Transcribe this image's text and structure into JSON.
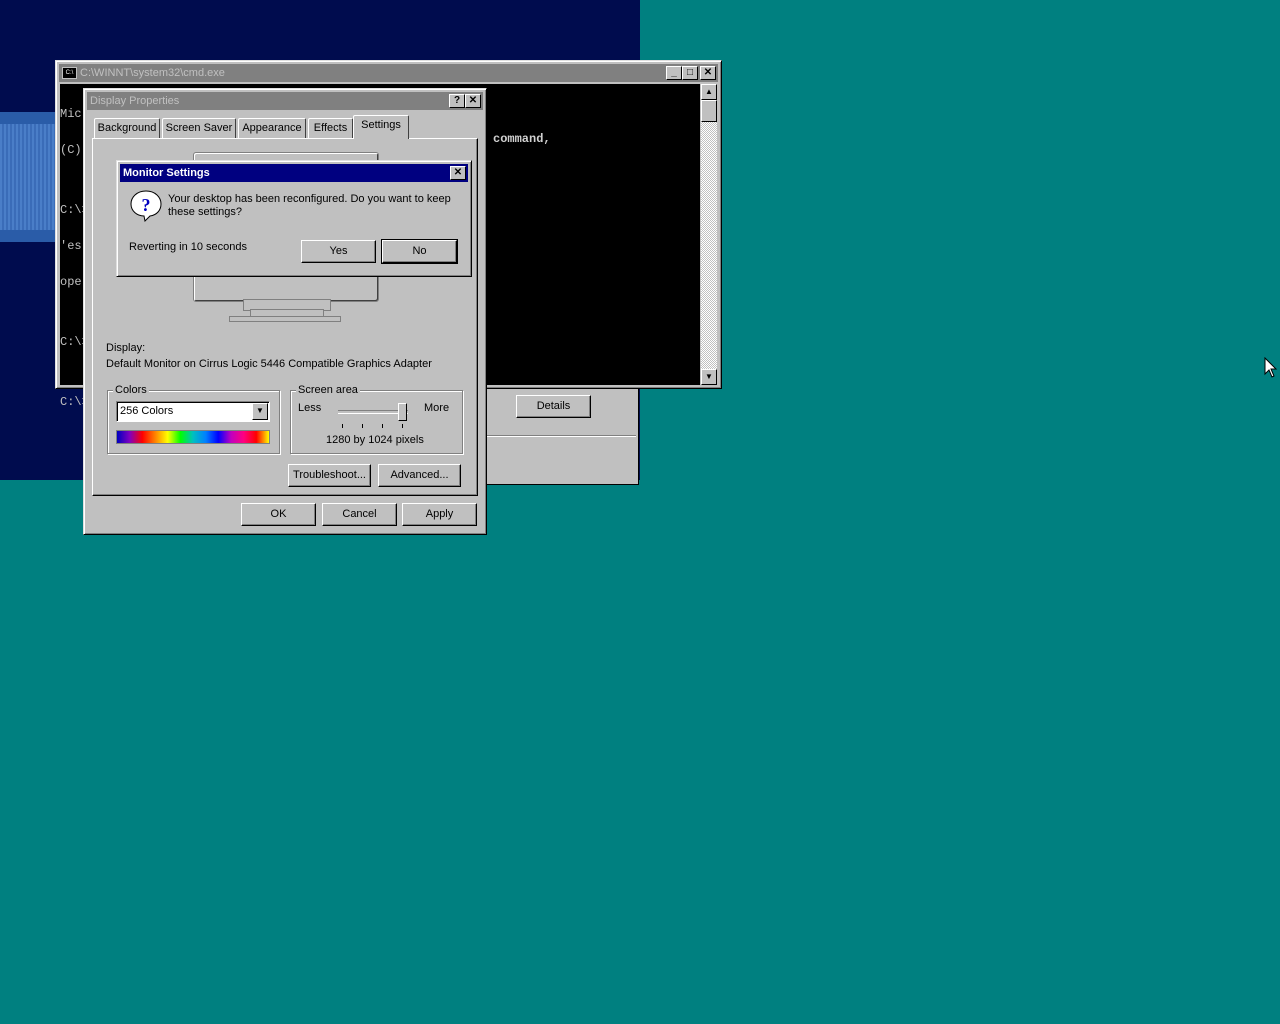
{
  "cmd_window": {
    "title": "C:\\WINNT\\system32\\cmd.exe",
    "lines": [
      "Microsoft Windows 2000 [Version 5.00.2195]",
      "(C) Copyright 1985-2000 Microsoft Corp.",
      "",
      "C:\\>",
      "'es",
      "ope",
      "",
      "C:\\>",
      "",
      "C:\\>"
    ],
    "visible_fragment": "command,"
  },
  "bg_dialog": {
    "details_label": "Details"
  },
  "display_properties": {
    "title": "Display Properties",
    "help_label": "?",
    "tabs": [
      "Background",
      "Screen Saver",
      "Appearance",
      "Effects",
      "Settings"
    ],
    "active_tab": "Settings",
    "display_label": "Display:",
    "display_value": "Default Monitor on Cirrus Logic 5446 Compatible Graphics Adapter",
    "colors_group": "Colors",
    "colors_value": "256 Colors",
    "screen_area_group": "Screen area",
    "less_label": "Less",
    "more_label": "More",
    "resolution": "1280 by 1024 pixels",
    "troubleshoot_label": "Troubleshoot...",
    "advanced_label": "Advanced...",
    "ok_label": "OK",
    "cancel_label": "Cancel",
    "apply_label": "Apply"
  },
  "monitor_settings": {
    "title": "Monitor Settings",
    "message": "Your desktop has been reconfigured.  Do you want to keep these settings?",
    "countdown": "Reverting in 10 seconds",
    "yes_label": "Yes",
    "no_label": "No",
    "icon": "question-icon"
  }
}
